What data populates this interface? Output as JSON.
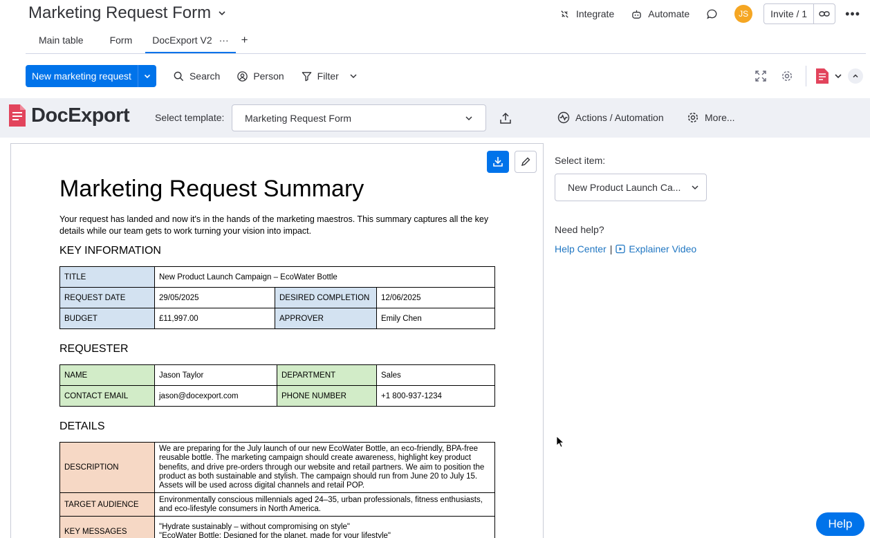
{
  "header": {
    "board_title": "Marketing Request Form",
    "integrate_label": "Integrate",
    "automate_label": "Automate",
    "avatar_initials": "JS",
    "invite_label": "Invite / 1"
  },
  "tabs": [
    {
      "label": "Main table"
    },
    {
      "label": "Form"
    },
    {
      "label": "DocExport V2"
    }
  ],
  "toolbar": {
    "new_item_label": "New marketing request",
    "search_label": "Search",
    "person_label": "Person",
    "filter_label": "Filter"
  },
  "docexport": {
    "logo_text": "DocExport",
    "select_template_label": "Select template:",
    "template_value": "Marketing Request Form",
    "actions_label": "Actions / Automation",
    "more_label": "More..."
  },
  "document": {
    "title": "Marketing Request Summary",
    "intro": "Your request has landed and now it's in the hands of the marketing maestros. This summary captures all the key details while our team gets to work turning your vision into impact.",
    "key_info_heading": "KEY INFORMATION",
    "key_info": {
      "title_key": "TITLE",
      "title_value": "New Product Launch Campaign – EcoWater Bottle",
      "request_date_key": "REQUEST DATE",
      "request_date_value": "29/05/2025",
      "desired_completion_key": "DESIRED COMPLETION",
      "desired_completion_value": "12/06/2025",
      "budget_key": "BUDGET",
      "budget_value": "£11,997.00",
      "approver_key": "APPROVER",
      "approver_value": "Emily Chen"
    },
    "requester_heading": "REQUESTER",
    "requester": {
      "name_key": "NAME",
      "name_value": "Jason Taylor",
      "department_key": "DEPARTMENT",
      "department_value": "Sales",
      "email_key": "CONTACT EMAIL",
      "email_value": "jason@docexport.com",
      "phone_key": "PHONE NUMBER",
      "phone_value": "+1 800-937-1234"
    },
    "details_heading": "DETAILS",
    "details": {
      "description_key": "DESCRIPTION",
      "description_value": "We are preparing for the July launch of our new EcoWater Bottle, an eco-friendly, BPA-free reusable bottle. The marketing campaign should create awareness, highlight key product benefits, and drive pre-orders through our website and retail partners. We aim to position the product as both sustainable and stylish. The campaign should run from June 20 to July 15. Assets will be used across digital channels and retail POP.",
      "audience_key": "TARGET AUDIENCE",
      "audience_value": "Environmentally conscious millennials aged 24–35, urban professionals, fitness enthusiasts, and eco-lifestyle consumers in North America.",
      "messages_key": "KEY MESSAGES",
      "messages_line1": "\"Hydrate sustainably – without compromising on style\"",
      "messages_line2": "\"EcoWater Bottle: Designed for the planet, made for your lifestyle\""
    }
  },
  "right_panel": {
    "select_item_label": "Select item:",
    "item_value": "New Product Launch Ca...",
    "need_help_label": "Need help?",
    "help_center_link": "Help Center",
    "separator": "|",
    "explainer_link": "Explainer Video"
  },
  "help_button_label": "Help",
  "colors": {
    "primary": "#0073ea",
    "key_info_cell": "#d3e2f1",
    "requester_cell": "#d2ecc8",
    "details_cell": "#f6d8c5",
    "docexport_red": "#e2445c"
  }
}
